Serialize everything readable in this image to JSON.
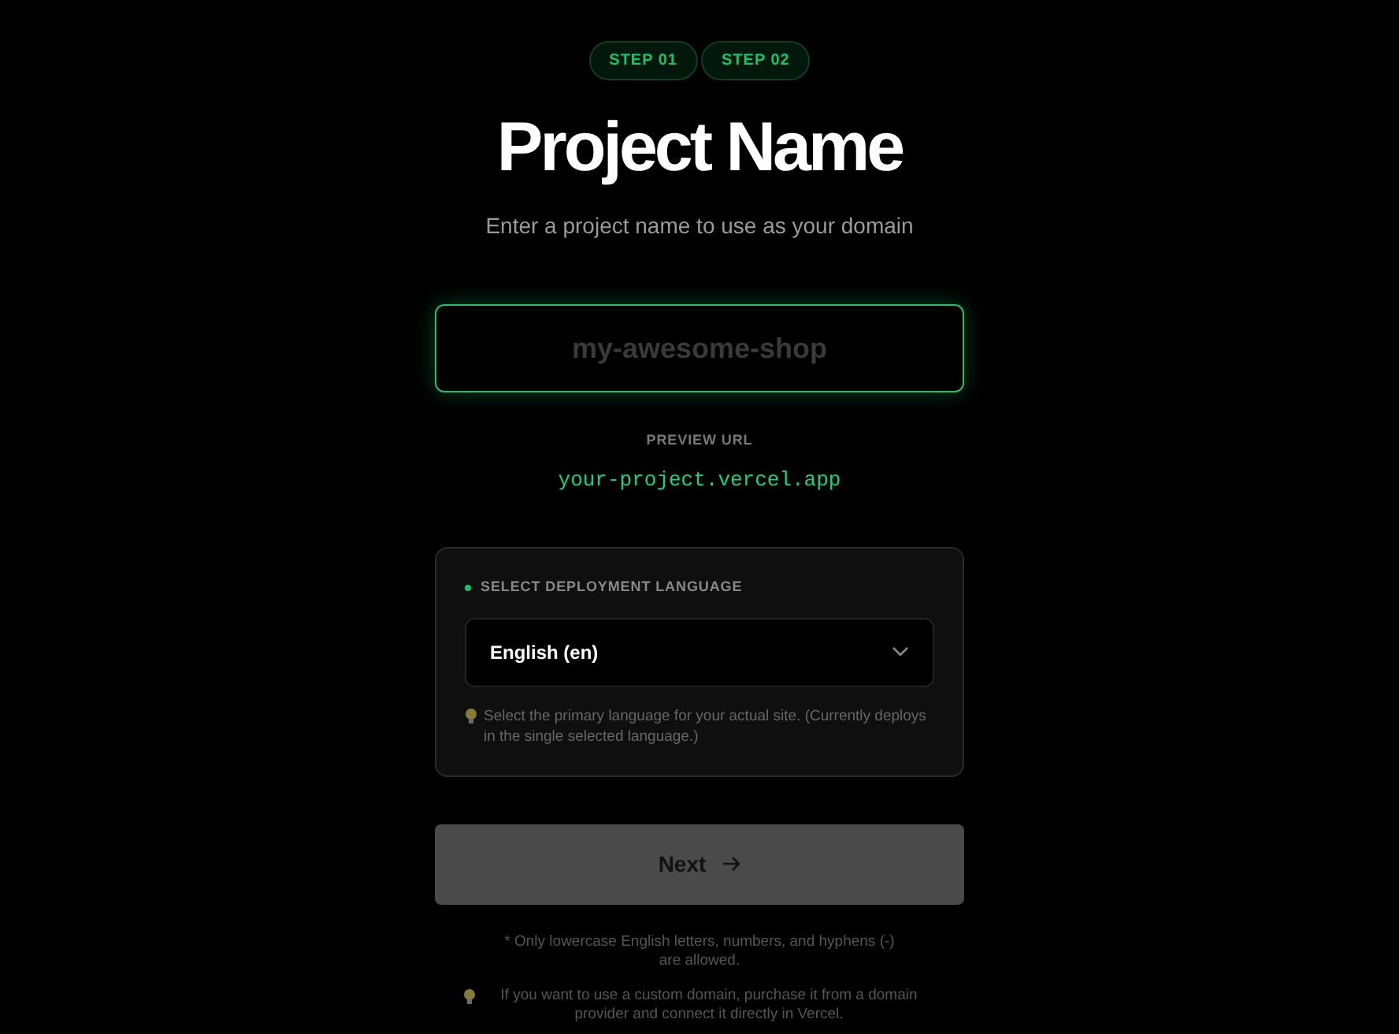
{
  "steps": [
    {
      "label": "STEP 01",
      "selected": true
    },
    {
      "label": "STEP 02",
      "selected": true
    }
  ],
  "title": "Project Name",
  "subtitle": "Enter a project name to use as your domain",
  "name_field": {
    "placeholder": "my-awesome-shop"
  },
  "preview": {
    "label": "PREVIEW URL",
    "url": "your-project.vercel.app"
  },
  "language_card": {
    "label": "SELECT DEPLOYMENT LANGUAGE",
    "value": "English (en)",
    "hint": "Select the primary language for your actual site. (Currently deploys in the single selected language.)"
  },
  "next_button": {
    "label": "Next",
    "disabled": true
  },
  "notes": [
    {
      "text": "* Only lowercase English letters, numbers, and hyphens (-) are allowed.",
      "kind": "plain"
    },
    {
      "text": "If you want to use a custom domain, purchase it from a domain provider and connect it directly in Vercel.",
      "kind": "tip"
    }
  ]
}
